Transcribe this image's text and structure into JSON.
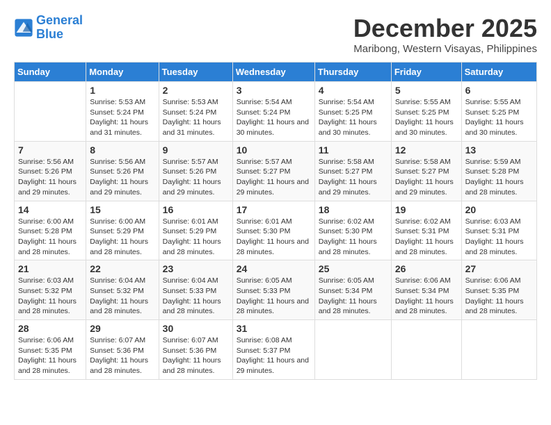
{
  "logo": {
    "line1": "General",
    "line2": "Blue"
  },
  "title": "December 2025",
  "subtitle": "Maribong, Western Visayas, Philippines",
  "weekdays": [
    "Sunday",
    "Monday",
    "Tuesday",
    "Wednesday",
    "Thursday",
    "Friday",
    "Saturday"
  ],
  "weeks": [
    [
      {
        "day": "",
        "sunrise": "",
        "sunset": "",
        "daylight": ""
      },
      {
        "day": "1",
        "sunrise": "Sunrise: 5:53 AM",
        "sunset": "Sunset: 5:24 PM",
        "daylight": "Daylight: 11 hours and 31 minutes."
      },
      {
        "day": "2",
        "sunrise": "Sunrise: 5:53 AM",
        "sunset": "Sunset: 5:24 PM",
        "daylight": "Daylight: 11 hours and 31 minutes."
      },
      {
        "day": "3",
        "sunrise": "Sunrise: 5:54 AM",
        "sunset": "Sunset: 5:24 PM",
        "daylight": "Daylight: 11 hours and 30 minutes."
      },
      {
        "day": "4",
        "sunrise": "Sunrise: 5:54 AM",
        "sunset": "Sunset: 5:25 PM",
        "daylight": "Daylight: 11 hours and 30 minutes."
      },
      {
        "day": "5",
        "sunrise": "Sunrise: 5:55 AM",
        "sunset": "Sunset: 5:25 PM",
        "daylight": "Daylight: 11 hours and 30 minutes."
      },
      {
        "day": "6",
        "sunrise": "Sunrise: 5:55 AM",
        "sunset": "Sunset: 5:25 PM",
        "daylight": "Daylight: 11 hours and 30 minutes."
      }
    ],
    [
      {
        "day": "7",
        "sunrise": "Sunrise: 5:56 AM",
        "sunset": "Sunset: 5:26 PM",
        "daylight": "Daylight: 11 hours and 29 minutes."
      },
      {
        "day": "8",
        "sunrise": "Sunrise: 5:56 AM",
        "sunset": "Sunset: 5:26 PM",
        "daylight": "Daylight: 11 hours and 29 minutes."
      },
      {
        "day": "9",
        "sunrise": "Sunrise: 5:57 AM",
        "sunset": "Sunset: 5:26 PM",
        "daylight": "Daylight: 11 hours and 29 minutes."
      },
      {
        "day": "10",
        "sunrise": "Sunrise: 5:57 AM",
        "sunset": "Sunset: 5:27 PM",
        "daylight": "Daylight: 11 hours and 29 minutes."
      },
      {
        "day": "11",
        "sunrise": "Sunrise: 5:58 AM",
        "sunset": "Sunset: 5:27 PM",
        "daylight": "Daylight: 11 hours and 29 minutes."
      },
      {
        "day": "12",
        "sunrise": "Sunrise: 5:58 AM",
        "sunset": "Sunset: 5:27 PM",
        "daylight": "Daylight: 11 hours and 29 minutes."
      },
      {
        "day": "13",
        "sunrise": "Sunrise: 5:59 AM",
        "sunset": "Sunset: 5:28 PM",
        "daylight": "Daylight: 11 hours and 28 minutes."
      }
    ],
    [
      {
        "day": "14",
        "sunrise": "Sunrise: 6:00 AM",
        "sunset": "Sunset: 5:28 PM",
        "daylight": "Daylight: 11 hours and 28 minutes."
      },
      {
        "day": "15",
        "sunrise": "Sunrise: 6:00 AM",
        "sunset": "Sunset: 5:29 PM",
        "daylight": "Daylight: 11 hours and 28 minutes."
      },
      {
        "day": "16",
        "sunrise": "Sunrise: 6:01 AM",
        "sunset": "Sunset: 5:29 PM",
        "daylight": "Daylight: 11 hours and 28 minutes."
      },
      {
        "day": "17",
        "sunrise": "Sunrise: 6:01 AM",
        "sunset": "Sunset: 5:30 PM",
        "daylight": "Daylight: 11 hours and 28 minutes."
      },
      {
        "day": "18",
        "sunrise": "Sunrise: 6:02 AM",
        "sunset": "Sunset: 5:30 PM",
        "daylight": "Daylight: 11 hours and 28 minutes."
      },
      {
        "day": "19",
        "sunrise": "Sunrise: 6:02 AM",
        "sunset": "Sunset: 5:31 PM",
        "daylight": "Daylight: 11 hours and 28 minutes."
      },
      {
        "day": "20",
        "sunrise": "Sunrise: 6:03 AM",
        "sunset": "Sunset: 5:31 PM",
        "daylight": "Daylight: 11 hours and 28 minutes."
      }
    ],
    [
      {
        "day": "21",
        "sunrise": "Sunrise: 6:03 AM",
        "sunset": "Sunset: 5:32 PM",
        "daylight": "Daylight: 11 hours and 28 minutes."
      },
      {
        "day": "22",
        "sunrise": "Sunrise: 6:04 AM",
        "sunset": "Sunset: 5:32 PM",
        "daylight": "Daylight: 11 hours and 28 minutes."
      },
      {
        "day": "23",
        "sunrise": "Sunrise: 6:04 AM",
        "sunset": "Sunset: 5:33 PM",
        "daylight": "Daylight: 11 hours and 28 minutes."
      },
      {
        "day": "24",
        "sunrise": "Sunrise: 6:05 AM",
        "sunset": "Sunset: 5:33 PM",
        "daylight": "Daylight: 11 hours and 28 minutes."
      },
      {
        "day": "25",
        "sunrise": "Sunrise: 6:05 AM",
        "sunset": "Sunset: 5:34 PM",
        "daylight": "Daylight: 11 hours and 28 minutes."
      },
      {
        "day": "26",
        "sunrise": "Sunrise: 6:06 AM",
        "sunset": "Sunset: 5:34 PM",
        "daylight": "Daylight: 11 hours and 28 minutes."
      },
      {
        "day": "27",
        "sunrise": "Sunrise: 6:06 AM",
        "sunset": "Sunset: 5:35 PM",
        "daylight": "Daylight: 11 hours and 28 minutes."
      }
    ],
    [
      {
        "day": "28",
        "sunrise": "Sunrise: 6:06 AM",
        "sunset": "Sunset: 5:35 PM",
        "daylight": "Daylight: 11 hours and 28 minutes."
      },
      {
        "day": "29",
        "sunrise": "Sunrise: 6:07 AM",
        "sunset": "Sunset: 5:36 PM",
        "daylight": "Daylight: 11 hours and 28 minutes."
      },
      {
        "day": "30",
        "sunrise": "Sunrise: 6:07 AM",
        "sunset": "Sunset: 5:36 PM",
        "daylight": "Daylight: 11 hours and 28 minutes."
      },
      {
        "day": "31",
        "sunrise": "Sunrise: 6:08 AM",
        "sunset": "Sunset: 5:37 PM",
        "daylight": "Daylight: 11 hours and 29 minutes."
      },
      {
        "day": "",
        "sunrise": "",
        "sunset": "",
        "daylight": ""
      },
      {
        "day": "",
        "sunrise": "",
        "sunset": "",
        "daylight": ""
      },
      {
        "day": "",
        "sunrise": "",
        "sunset": "",
        "daylight": ""
      }
    ]
  ]
}
